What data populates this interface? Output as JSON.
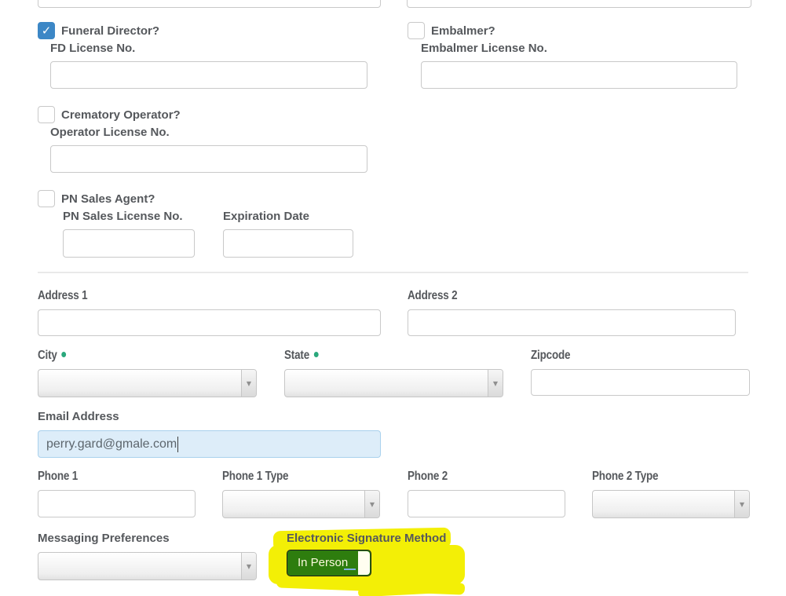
{
  "colors": {
    "checkbox_checked_blue": "#3c87c6",
    "label_gray": "#55585c",
    "input_border": "#c9c9c9",
    "required_dot_green": "#2aa87c",
    "email_field_bg": "#ddedf9",
    "email_field_border": "#a9d1ed",
    "highlight_yellow": "#f3ef06",
    "esign_button_green": "#2e7d0e"
  },
  "icons": {
    "check": "✓",
    "dropdown_arrow": "▼"
  },
  "form": {
    "funeral_director": {
      "label": "Funeral Director?",
      "checked": true,
      "license_label": "FD License No.",
      "license_value": ""
    },
    "embalmer": {
      "label": "Embalmer?",
      "checked": false,
      "license_label": "Embalmer License No.",
      "license_value": ""
    },
    "crematory_operator": {
      "label": "Crematory Operator?",
      "checked": false,
      "license_label": "Operator License No.",
      "license_value": ""
    },
    "pn_sales_agent": {
      "label": "PN Sales Agent?",
      "checked": false,
      "license_label": "PN Sales License No.",
      "license_value": "",
      "expiration_label": "Expiration Date",
      "expiration_value": ""
    },
    "address1": {
      "label": "Address 1",
      "value": ""
    },
    "address2": {
      "label": "Address 2",
      "value": ""
    },
    "city": {
      "label": "City",
      "required": true,
      "value": ""
    },
    "state": {
      "label": "State",
      "required": true,
      "value": ""
    },
    "zipcode": {
      "label": "Zipcode",
      "value": ""
    },
    "email": {
      "label": "Email Address",
      "value": "perry.gard@gmale.com"
    },
    "phone1": {
      "label": "Phone 1",
      "value": ""
    },
    "phone1_type": {
      "label": "Phone 1 Type",
      "value": ""
    },
    "phone2": {
      "label": "Phone 2",
      "value": ""
    },
    "phone2_type": {
      "label": "Phone 2 Type",
      "value": ""
    },
    "messaging_preferences": {
      "label": "Messaging Preferences",
      "value": ""
    },
    "esignature": {
      "label": "Electronic Signature Method",
      "value": "In Person",
      "annotation": "yellow-highlighter"
    }
  }
}
